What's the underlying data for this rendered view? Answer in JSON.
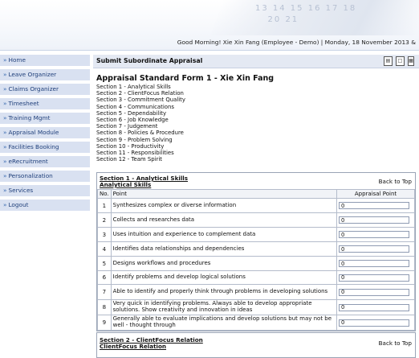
{
  "header": {
    "calendar_numbers": "13 14 15 16 17 18\n   20 21",
    "greeting": "Good Morning! Xie Xin Fang (Employee - Demo) | Monday, 18 November 2013 &"
  },
  "sidebar": {
    "items": [
      {
        "label": "Home"
      },
      {
        "label": "Leave Organizer"
      },
      {
        "label": "Claims Organizer"
      },
      {
        "label": "Timesheet"
      },
      {
        "label": "Training Mgmt"
      },
      {
        "label": "Appraisal Module"
      },
      {
        "label": "Facilities Booking"
      },
      {
        "label": "eRecruitment"
      },
      {
        "label": "Personalization"
      },
      {
        "label": "Services"
      },
      {
        "label": "Logout"
      }
    ]
  },
  "main": {
    "page_title": "Submit Subordinate Appraisal",
    "form_title": "Appraisal Standard Form 1 - Xie Xin Fang",
    "sections": [
      "Section 1 - Analytical Skills",
      "Section 2 - ClientFocus Relation",
      "Section 3 - Commitment Quality",
      "Section 4 - Communications",
      "Section 5 - Dependability",
      "Section 6 - Job Knowledge",
      "Section 7 - Judgement",
      "Section 8 - Policies & Procedure",
      "Section 9 - Problem Solving",
      "Section 10 - Productivity",
      "Section 11 - Responsibilities",
      "Section 12 - Team Spirit"
    ],
    "panel1": {
      "heading": "Section 1 - Analytical Skills",
      "subheading": "Analytical Skills",
      "back_to_top": "Back to Top",
      "columns": {
        "no": "No.",
        "point": "Point",
        "appraisal": "Appraisal Point"
      },
      "rows": [
        {
          "no": "1",
          "point": "Synthesizes complex or diverse information",
          "value": "0"
        },
        {
          "no": "2",
          "point": "Collects and researches data",
          "value": "0"
        },
        {
          "no": "3",
          "point": "Uses intuition and experience to complement data",
          "value": "0"
        },
        {
          "no": "4",
          "point": "Identifies data relationships and dependencies",
          "value": "0"
        },
        {
          "no": "5",
          "point": "Designs workflows and procedures",
          "value": "0"
        },
        {
          "no": "6",
          "point": "Identify problems and develop logical solutions",
          "value": "0"
        },
        {
          "no": "7",
          "point": "Able to identify and properly think through problems in developing solutions",
          "value": "0"
        },
        {
          "no": "8",
          "point": "Very quick in identifying problems. Always able to develop appropriate solutions. Show creativity and innovation in ideas",
          "value": "0"
        },
        {
          "no": "9",
          "point": "Generally able to evaluate implications and develop solutions but may not be well - thought through",
          "value": "0"
        }
      ]
    },
    "panel2": {
      "heading": "Section 2 - ClientFocus Relation",
      "subheading": "ClientFocus Relation",
      "back_to_top": "Back to Top"
    }
  }
}
